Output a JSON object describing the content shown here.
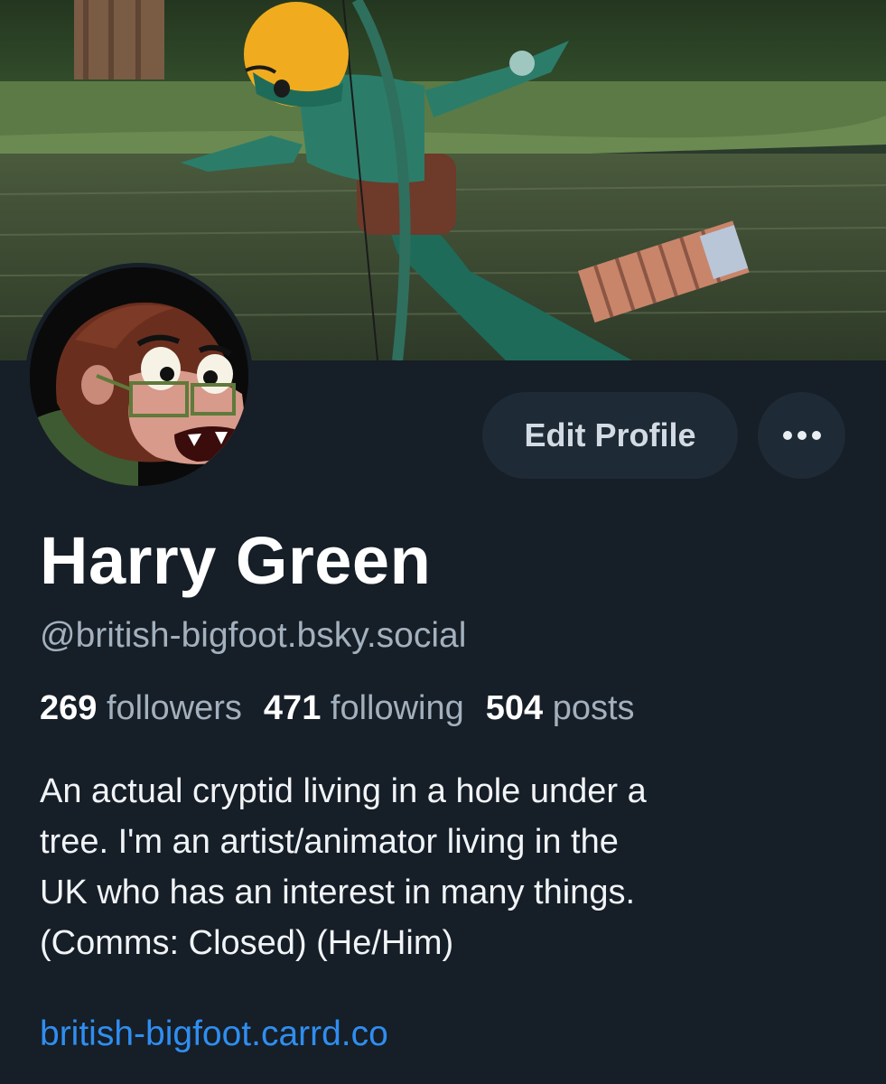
{
  "profile": {
    "display_name": "Harry Green",
    "handle": "@british-bigfoot.bsky.social",
    "stats": {
      "followers_count": "269",
      "followers_label": "followers",
      "following_count": "471",
      "following_label": "following",
      "posts_count": "504",
      "posts_label": "posts"
    },
    "bio_lines": [
      "An actual cryptid living in a hole under a",
      "tree. I'm an artist/animator living in the",
      "UK who has an interest in many things.",
      "(Comms: Closed) (He/Him)"
    ],
    "website": "british-bigfoot.carrd.co"
  },
  "actions": {
    "edit_label": "Edit Profile",
    "more_icon": "more-horizontal-icon"
  },
  "colors": {
    "background": "#161e27",
    "button_bg": "#1e2a36",
    "link": "#2f8ef0",
    "muted_text": "#a3b0bd"
  }
}
